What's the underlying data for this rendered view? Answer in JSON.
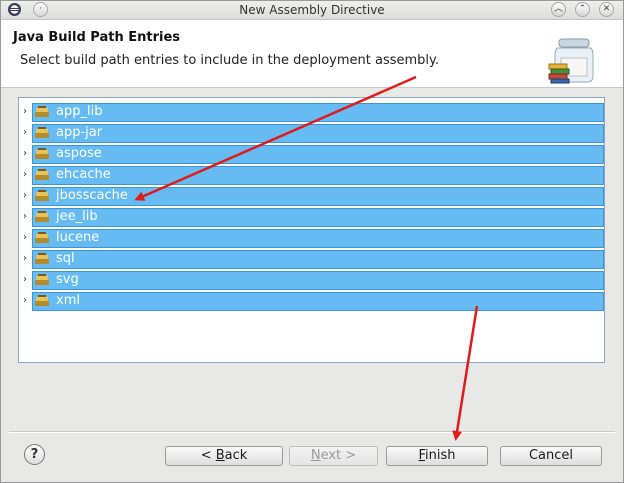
{
  "window": {
    "title": "New Assembly Directive"
  },
  "header": {
    "title": "Java Build Path Entries",
    "description": "Select build path entries to include in the deployment assembly."
  },
  "tree": {
    "items": [
      {
        "label": "app_lib"
      },
      {
        "label": "app-jar"
      },
      {
        "label": "aspose"
      },
      {
        "label": "ehcache"
      },
      {
        "label": "jbosscache"
      },
      {
        "label": "jee_lib"
      },
      {
        "label": "lucene"
      },
      {
        "label": "sql"
      },
      {
        "label": "svg"
      },
      {
        "label": "xml"
      }
    ],
    "selection_color": "#65bbf2"
  },
  "buttons": {
    "back_prefix": "< ",
    "back_mnemonic": "B",
    "back_rest": "ack",
    "next_prefix": "",
    "next_mnemonic": "N",
    "next_rest": "ext >",
    "finish_mnemonic": "F",
    "finish_rest": "inish",
    "cancel": "Cancel"
  },
  "icons": {
    "app": "eclipse-icon",
    "help": "help-icon",
    "library": "library-jar-icon",
    "wizard": "jar-wizard-icon"
  },
  "annotation_color": "#e01b1b"
}
